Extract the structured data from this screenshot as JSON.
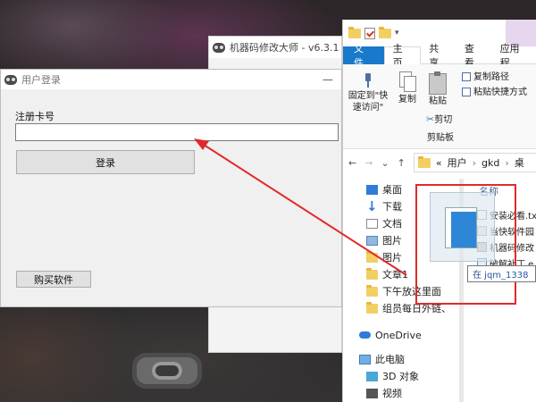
{
  "login_window": {
    "title": "用户登录",
    "minimize": "—",
    "reg_label": "注册卡号",
    "reg_value": "",
    "login_button": "登录",
    "buy_button": "购买软件"
  },
  "main_app": {
    "title": "机器码修改大师 - v6.3.1"
  },
  "explorer": {
    "tabs": [
      "文件",
      "主页",
      "共享",
      "查看",
      "应用程"
    ],
    "ribbon": {
      "pin_label_1": "固定到\"快",
      "pin_label_2": "速访问\"",
      "copy_label": "复制",
      "paste_label": "粘贴",
      "copy_path": "复制路径",
      "paste_shortcut": "粘贴快捷方式",
      "cut": "剪切",
      "group_clipboard": "剪贴板"
    },
    "address": {
      "back": "←",
      "forward": "→",
      "recent": "⌄",
      "up": "↑",
      "prefix": "«",
      "path": [
        "用户",
        "gkd",
        "桌"
      ]
    },
    "nav": [
      "桌面",
      "下载",
      "文档",
      "图片",
      "图片",
      "文章1",
      "下午放这里面",
      "组员每日外链、",
      "OneDrive",
      "此电脑",
      "3D 对象",
      "视频"
    ],
    "file_header": "名称",
    "files": [
      "安装必看.tx",
      "当快软件园",
      "机器码修改",
      "破解补丁.e"
    ],
    "tooltip": "在 jqm_1338"
  },
  "colors": {
    "file_tab": "#1979ca",
    "annotation_red": "#e02a2a"
  }
}
